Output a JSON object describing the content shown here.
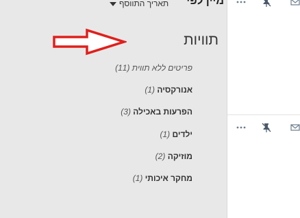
{
  "header": {
    "title_cropped": "מיין לפי",
    "sort_label": "תאריך התווסף",
    "sort_icon": "caret-down-icon"
  },
  "tags": {
    "heading": "תוויות",
    "items": [
      {
        "name": "פריטים ללא תווית",
        "count": "(11)"
      },
      {
        "name": "אנורקסיה",
        "count": "(1)"
      },
      {
        "name": "הפרעות באכילה",
        "count": "(3)"
      },
      {
        "name": "ילדים",
        "count": "(1)"
      },
      {
        "name": "מוזיקה",
        "count": "(2)"
      },
      {
        "name": "מחקר איכותי",
        "count": "(1)"
      }
    ]
  },
  "row_tools": {
    "icons": [
      "more-icon",
      "unpin-icon",
      "mail-icon"
    ]
  },
  "colors": {
    "panel_bg": "#e8e8e8",
    "arrow_red": "#e0201c",
    "icon_gray": "#6b7c8c"
  }
}
